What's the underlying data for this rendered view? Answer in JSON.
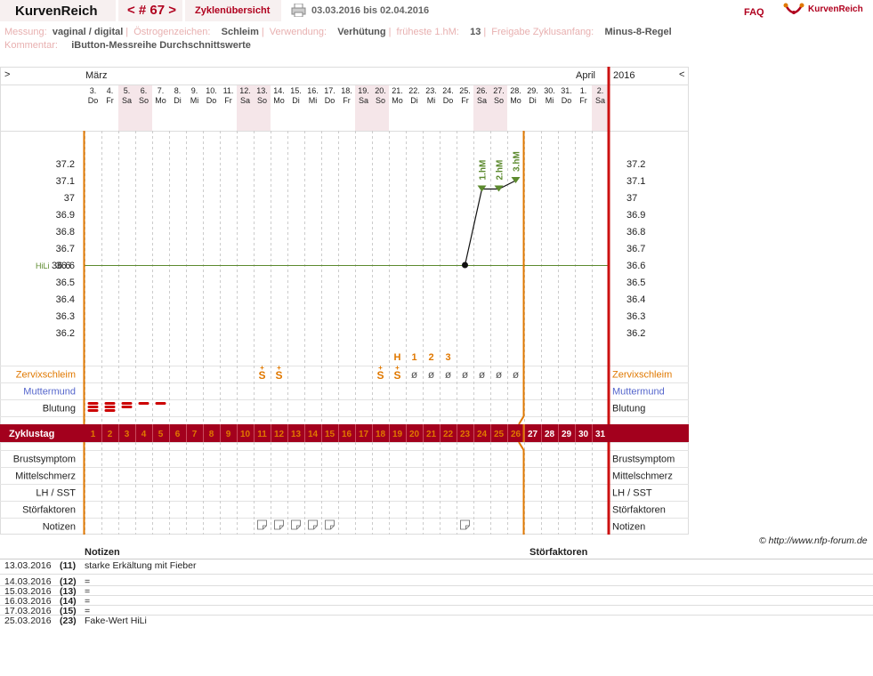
{
  "header": {
    "brand": "KurvenReich",
    "cycle_nav": "< # 67 >",
    "overview": "Zyklenübersicht",
    "date_range": "03.03.2016 bis 02.04.2016",
    "faq": "FAQ",
    "logo": "KurvenReich"
  },
  "meta_line1": [
    {
      "key": "Messung:",
      "value": "vaginal / digital"
    },
    {
      "key": "Östrogenzeichen:",
      "value": "Schleim"
    },
    {
      "key": "Verwendung:",
      "value": "Verhütung"
    },
    {
      "key": "früheste 1.hM:",
      "value": "13"
    },
    {
      "key": "Freigabe Zyklusanfang:",
      "value": "Minus-8-Regel"
    }
  ],
  "meta_line2": {
    "key": "Kommentar:",
    "value": "iButton-Messreihe Durchschnittswerte"
  },
  "chart_data": {
    "type": "line",
    "month_left": "März",
    "month_right": "April",
    "year": "2016",
    "nav_left": ">",
    "nav_right": "<",
    "days": [
      {
        "d": "3.",
        "w": "Do",
        "we": false
      },
      {
        "d": "4.",
        "w": "Fr",
        "we": false
      },
      {
        "d": "5.",
        "w": "Sa",
        "we": true
      },
      {
        "d": "6.",
        "w": "So",
        "we": true
      },
      {
        "d": "7.",
        "w": "Mo",
        "we": false
      },
      {
        "d": "8.",
        "w": "Di",
        "we": false
      },
      {
        "d": "9.",
        "w": "Mi",
        "we": false
      },
      {
        "d": "10.",
        "w": "Do",
        "we": false
      },
      {
        "d": "11.",
        "w": "Fr",
        "we": false
      },
      {
        "d": "12.",
        "w": "Sa",
        "we": true
      },
      {
        "d": "13.",
        "w": "So",
        "we": true
      },
      {
        "d": "14.",
        "w": "Mo",
        "we": false
      },
      {
        "d": "15.",
        "w": "Di",
        "we": false
      },
      {
        "d": "16.",
        "w": "Mi",
        "we": false
      },
      {
        "d": "17.",
        "w": "Do",
        "we": false
      },
      {
        "d": "18.",
        "w": "Fr",
        "we": false
      },
      {
        "d": "19.",
        "w": "Sa",
        "we": true
      },
      {
        "d": "20.",
        "w": "So",
        "we": true
      },
      {
        "d": "21.",
        "w": "Mo",
        "we": false
      },
      {
        "d": "22.",
        "w": "Di",
        "we": false
      },
      {
        "d": "23.",
        "w": "Mi",
        "we": false
      },
      {
        "d": "24.",
        "w": "Do",
        "we": false
      },
      {
        "d": "25.",
        "w": "Fr",
        "we": false
      },
      {
        "d": "26.",
        "w": "Sa",
        "we": true
      },
      {
        "d": "27.",
        "w": "So",
        "we": true
      },
      {
        "d": "28.",
        "w": "Mo",
        "we": false
      },
      {
        "d": "29.",
        "w": "Di",
        "we": false
      },
      {
        "d": "30.",
        "w": "Mi",
        "we": false
      },
      {
        "d": "31.",
        "w": "Do",
        "we": false
      },
      {
        "d": "1.",
        "w": "Fr",
        "we": false
      },
      {
        "d": "2.",
        "w": "Sa",
        "we": true
      }
    ],
    "y_ticks": [
      "37.2",
      "37.1",
      "37",
      "36.9",
      "36.8",
      "36.7",
      "36.6",
      "36.5",
      "36.4",
      "36.3",
      "36.2"
    ],
    "ylim": [
      36.1,
      37.3
    ],
    "hili_label": "HiLi",
    "hili_value": 36.6,
    "temperatures": [
      {
        "day": 23,
        "value": 36.6
      },
      {
        "day": 24,
        "value": 37.05
      },
      {
        "day": 25,
        "value": 37.05
      },
      {
        "day": 26,
        "value": 37.1
      }
    ],
    "hm_labels": [
      {
        "day": 24,
        "text": "1.hM"
      },
      {
        "day": 25,
        "text": "2.hM"
      },
      {
        "day": 26,
        "text": "3.hM"
      }
    ],
    "mucus_peak": [
      {
        "day": 19,
        "text": "H"
      },
      {
        "day": 20,
        "text": "1"
      },
      {
        "day": 21,
        "text": "2"
      },
      {
        "day": 22,
        "text": "3"
      }
    ],
    "mucus": [
      {
        "day": 11,
        "sym": "S+"
      },
      {
        "day": 12,
        "sym": "S+"
      },
      {
        "day": 18,
        "sym": "S+"
      },
      {
        "day": 19,
        "sym": "S+"
      },
      {
        "day": 20,
        "sym": "ø"
      },
      {
        "day": 21,
        "sym": "ø"
      },
      {
        "day": 22,
        "sym": "ø"
      },
      {
        "day": 23,
        "sym": "ø"
      },
      {
        "day": 24,
        "sym": "ø"
      },
      {
        "day": 25,
        "sym": "ø"
      },
      {
        "day": 26,
        "sym": "ø"
      }
    ],
    "bleeding": [
      {
        "day": 1,
        "level": 3
      },
      {
        "day": 2,
        "level": 3
      },
      {
        "day": 3,
        "level": 2
      },
      {
        "day": 4,
        "level": 1
      },
      {
        "day": 5,
        "level": 1
      }
    ],
    "notes_days": [
      11,
      12,
      13,
      14,
      15,
      23
    ],
    "row_labels": {
      "zervix": "Zervixschleim",
      "muttermund": "Muttermund",
      "blutung": "Blutung",
      "zyklustag": "Zyklustag",
      "brust": "Brustsymptom",
      "mittel": "Mittelschmerz",
      "lh": "LH / SST",
      "stoer": "Störfaktoren",
      "notizen": "Notizen"
    },
    "cycle_days": [
      "1",
      "2",
      "3",
      "4",
      "5",
      "6",
      "7",
      "8",
      "9",
      "10",
      "11",
      "12",
      "13",
      "14",
      "15",
      "16",
      "17",
      "18",
      "19",
      "20",
      "21",
      "22",
      "23",
      "24",
      "25",
      "26",
      "27",
      "28",
      "29",
      "30",
      "31"
    ]
  },
  "copyright": "© http://www.nfp-forum.de",
  "notes": {
    "head_notes": "Notizen",
    "head_faults": "Störfaktoren",
    "rows": [
      {
        "date": "13.03.2016",
        "day": "(11)",
        "text": "starke Erkältung mit Fieber"
      },
      {
        "date": "14.03.2016",
        "day": "(12)",
        "text": "="
      },
      {
        "date": "15.03.2016",
        "day": "(13)",
        "text": "="
      },
      {
        "date": "16.03.2016",
        "day": "(14)",
        "text": "="
      },
      {
        "date": "17.03.2016",
        "day": "(15)",
        "text": "="
      },
      {
        "date": "25.03.2016",
        "day": "(23)",
        "text": "Fake-Wert HiLi"
      }
    ]
  },
  "colors": {
    "accent": "#b0001e",
    "orange": "#e07800",
    "green": "#5c8a2e",
    "blue": "#5566cc",
    "weekend": "#f5e6e9"
  }
}
